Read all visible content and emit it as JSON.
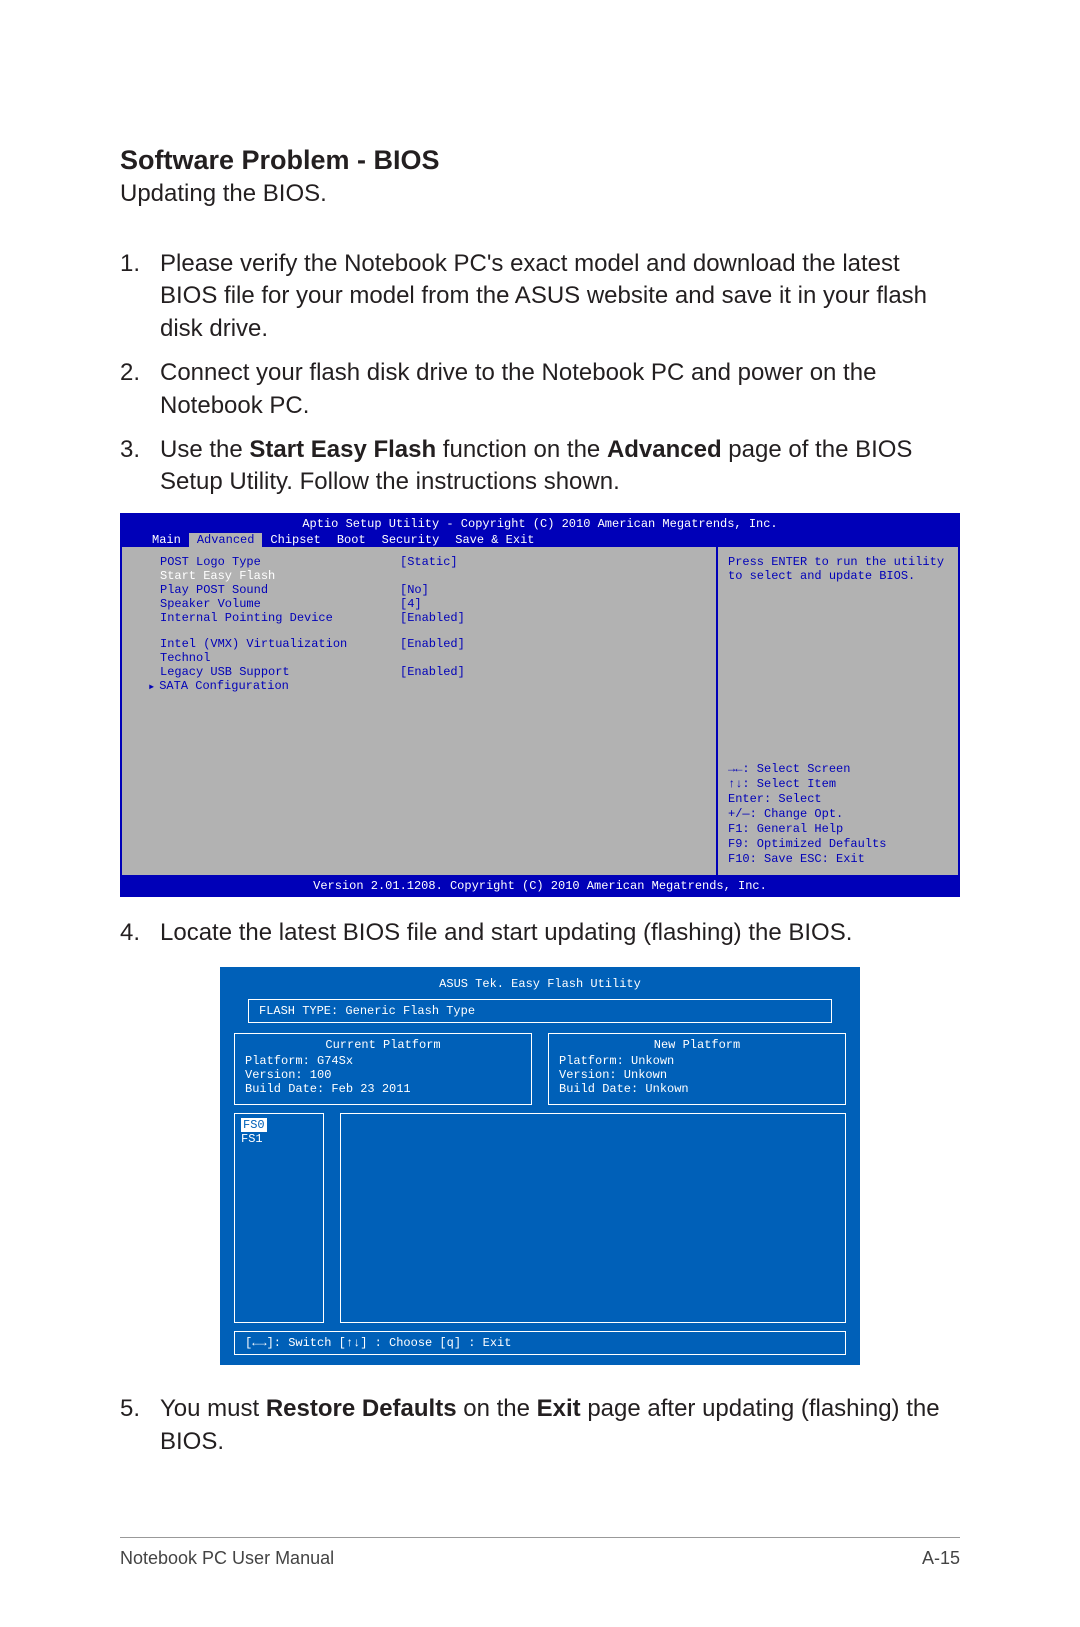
{
  "heading": "Software Problem - BIOS",
  "subtitle": "Updating the BIOS.",
  "steps": {
    "s1_num": "1.",
    "s1_a": "Please verify the Notebook PC's exact model and download the latest BIOS file for your model from the ASUS website and save it in your flash disk drive.",
    "s2_num": "2.",
    "s2_a": "Connect your flash disk drive to the Notebook PC and power on the Notebook PC.",
    "s3_num": "3.",
    "s3_a": "Use the ",
    "s3_b": "Start Easy Flash",
    "s3_c": " function on the ",
    "s3_d": "Advanced",
    "s3_e": " page of the BIOS Setup Utility. Follow the instructions shown.",
    "s4_num": "4.",
    "s4_a": "Locate the latest BIOS file and start updating (flashing) the BIOS.",
    "s5_num": "5.",
    "s5_a": "You must ",
    "s5_b": "Restore Defaults",
    "s5_c": " on the ",
    "s5_d": "Exit",
    "s5_e": " page after updating (flashing) the BIOS."
  },
  "bios": {
    "header": "Aptio Setup Utility - Copyright (C) 2010 American Megatrends, Inc.",
    "tabs": [
      "Main",
      "Advanced",
      "Chipset",
      "Boot",
      "Security",
      "Save & Exit"
    ],
    "rows": [
      {
        "lbl": "POST Logo Type",
        "val": "[Static]"
      },
      {
        "lbl": "Start Easy Flash",
        "val": "",
        "selected": true
      },
      {
        "lbl": "Play POST Sound",
        "val": "[No]"
      },
      {
        "lbl": "Speaker Volume",
        "val": "[4]"
      },
      {
        "lbl": "Internal Pointing Device",
        "val": "[Enabled]"
      }
    ],
    "rows2": [
      {
        "lbl": "Intel (VMX) Virtualization Technol",
        "val": "[Enabled]"
      },
      {
        "lbl": "Legacy USB Support",
        "val": "[Enabled]"
      }
    ],
    "sata": "SATA Configuration",
    "help": "Press ENTER to run the utility to select and update BIOS.",
    "keys": [
      "→←: Select Screen",
      "↑↓:   Select Item",
      "Enter: Select",
      "+/—:  Change Opt.",
      "F1:   General Help",
      "F9:   Optimized Defaults",
      "F10:  Save   ESC: Exit"
    ],
    "footer": "Version 2.01.1208. Copyright (C) 2010 American Megatrends, Inc."
  },
  "flash": {
    "title": "ASUS Tek. Easy Flash Utility",
    "flashtype": "FLASH TYPE: Generic Flash Type",
    "current": {
      "title": "Current Platform",
      "l1": "Platform:  G74Sx",
      "l2": "Version:    100",
      "l3": "Build Date: Feb 23 2011"
    },
    "new": {
      "title": "New Platform",
      "l1": "Platform:   Unkown",
      "l2": "Version:    Unkown",
      "l3": "Build Date: Unkown"
    },
    "fs0": "FS0",
    "fs1": "FS1",
    "cmd": "[←→]: Switch   [↑↓] : Choose   [q] : Exit"
  },
  "footer": {
    "left": "Notebook PC User Manual",
    "right": "A-15"
  }
}
